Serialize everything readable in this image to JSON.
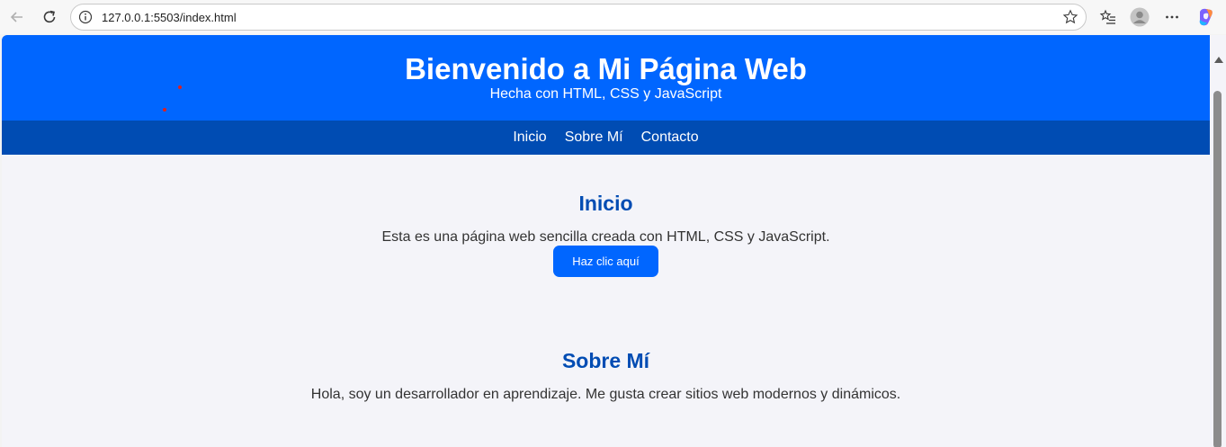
{
  "browser": {
    "url": "127.0.0.1:5503/index.html",
    "icons": [
      "back-arrow-icon",
      "reload-icon",
      "info-icon",
      "star-icon",
      "favorites-icon",
      "profile-icon",
      "more-icon",
      "copilot-icon"
    ]
  },
  "header": {
    "title": "Bienvenido a Mi Página Web",
    "subtitle": "Hecha con HTML, CSS y JavaScript",
    "background": "#0066ff"
  },
  "nav": {
    "background": "#004cb3",
    "items": [
      "Inicio",
      "Sobre Mí",
      "Contacto"
    ]
  },
  "sections": [
    {
      "title": "Inicio",
      "text": "Esta es una página web sencilla creada con HTML, CSS y JavaScript.",
      "button": "Haz clic aquí"
    },
    {
      "title": "Sobre Mí",
      "text": "Hola, soy un desarrollador en aprendizaje. Me gusta crear sitios web modernos y dinámicos."
    }
  ],
  "colors": {
    "accent": "#0066ff",
    "heading": "#004cb3",
    "page_background": "#f4f4f9",
    "text": "#333333"
  }
}
